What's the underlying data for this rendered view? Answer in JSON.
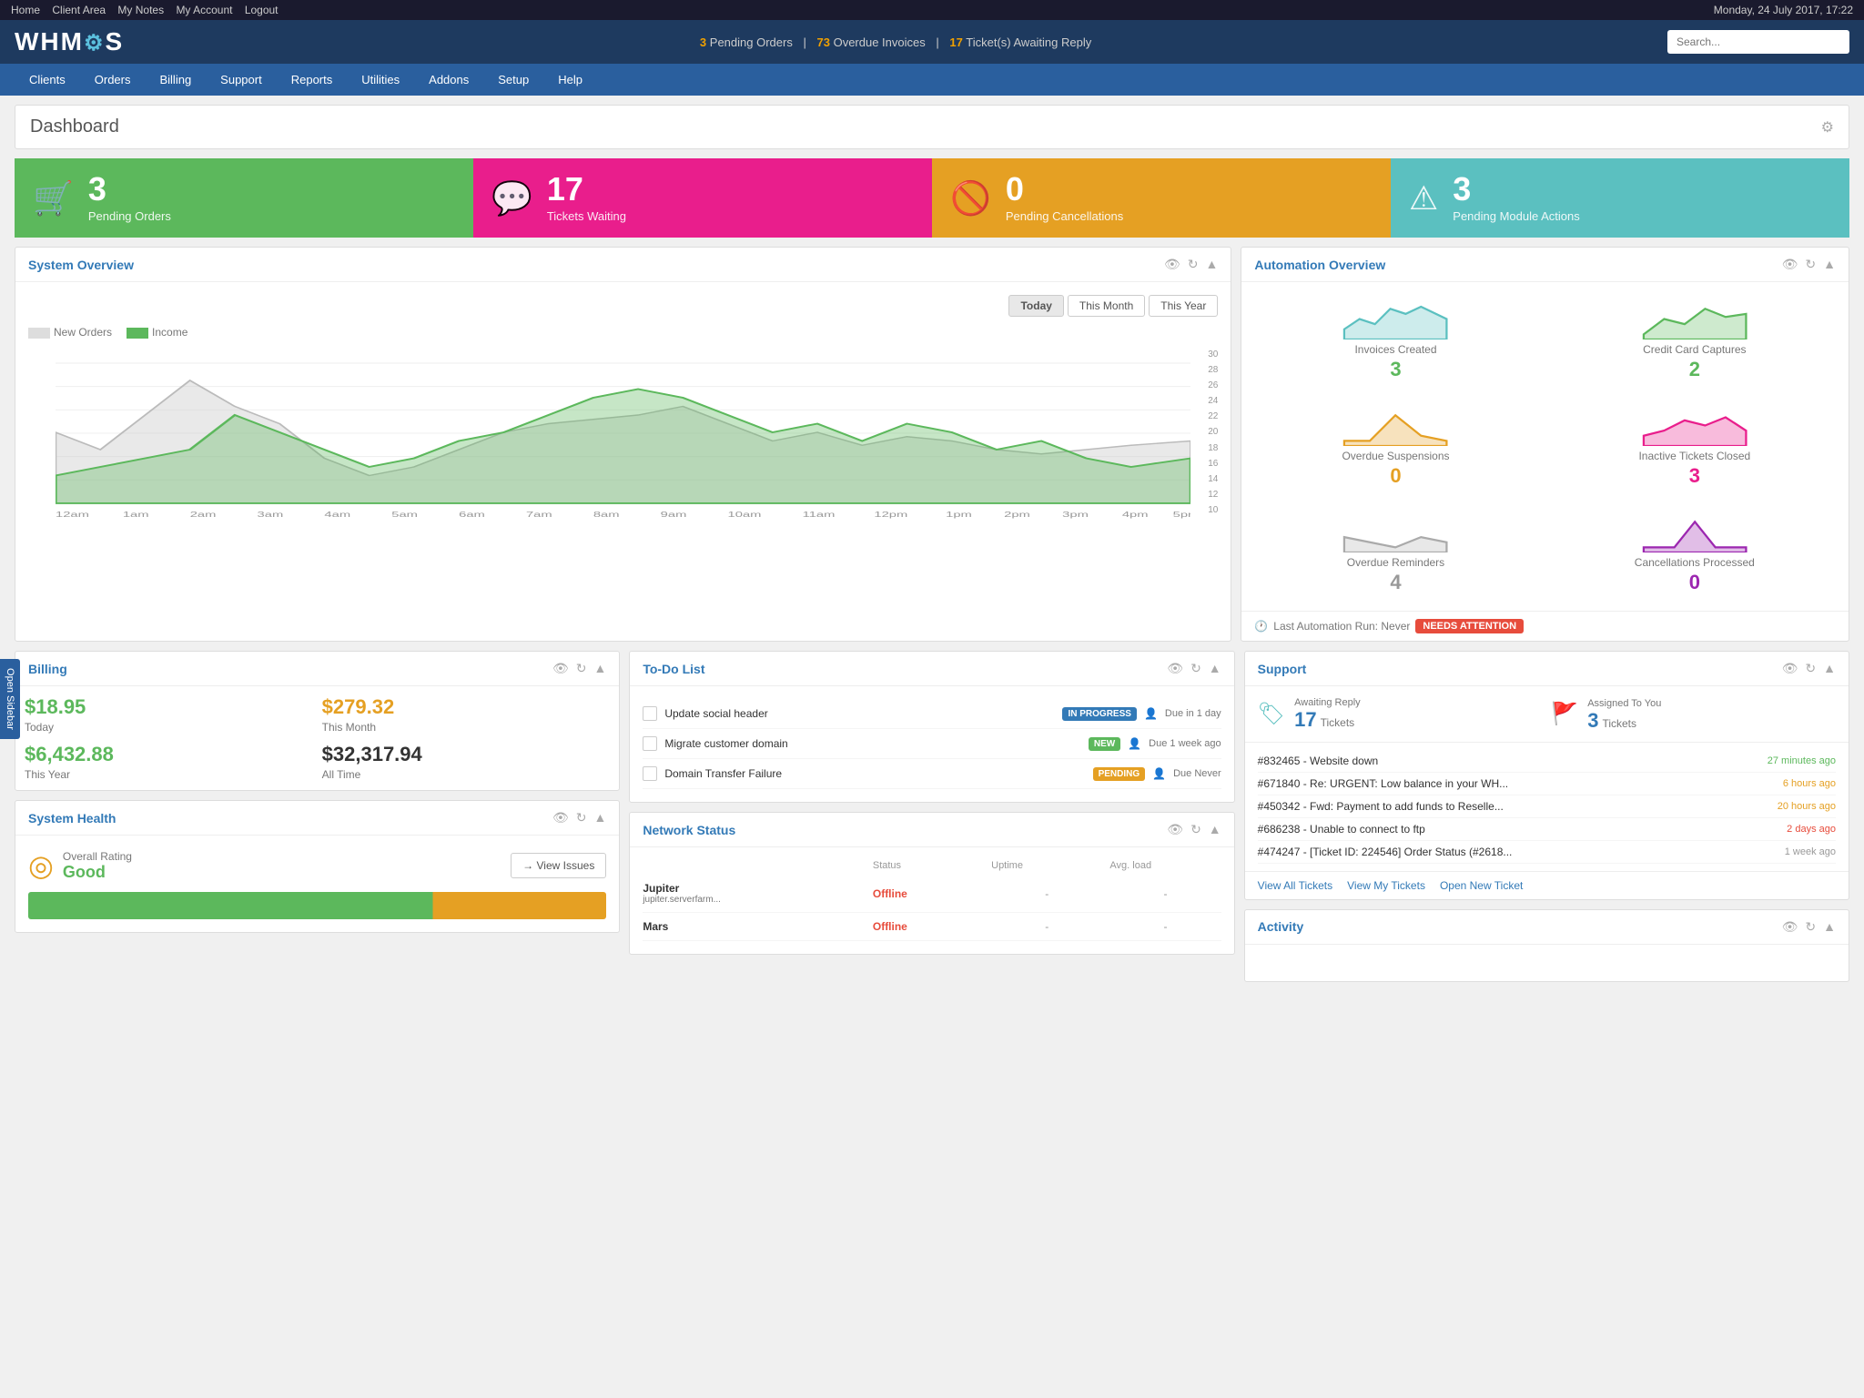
{
  "topbar": {
    "links": [
      "Home",
      "Client Area",
      "My Notes",
      "My Account",
      "Logout"
    ],
    "datetime": "Monday, 24 July 2017, 17:22"
  },
  "header": {
    "logo": "WHMC S",
    "notifications": {
      "pending_orders": "3",
      "overdue_invoices": "73",
      "tickets_awaiting": "17"
    },
    "search_placeholder": "Search..."
  },
  "nav": {
    "items": [
      "Clients",
      "Orders",
      "Billing",
      "Support",
      "Reports",
      "Utilities",
      "Addons",
      "Setup",
      "Help"
    ]
  },
  "dashboard": {
    "title": "Dashboard",
    "stats": [
      {
        "number": "3",
        "label": "Pending Orders",
        "color": "stat-green",
        "icon": "🛒"
      },
      {
        "number": "17",
        "label": "Tickets Waiting",
        "color": "stat-pink",
        "icon": "💬"
      },
      {
        "number": "0",
        "label": "Pending Cancellations",
        "color": "stat-orange",
        "icon": "🚫"
      },
      {
        "number": "3",
        "label": "Pending Module Actions",
        "color": "stat-teal",
        "icon": "⚠"
      }
    ]
  },
  "system_overview": {
    "title": "System Overview",
    "tabs": [
      "Today",
      "This Month",
      "This Year"
    ],
    "active_tab": "Today",
    "legend": {
      "new_orders": "New Orders",
      "income": "Income"
    }
  },
  "automation_overview": {
    "title": "Automation Overview",
    "items": [
      {
        "label": "Invoices Created",
        "value": "3",
        "color": "green",
        "chart": "teal"
      },
      {
        "label": "Credit Card Captures",
        "value": "2",
        "color": "green",
        "chart": "green"
      },
      {
        "label": "Overdue Suspensions",
        "value": "0",
        "color": "orange",
        "chart": "orange"
      },
      {
        "label": "Inactive Tickets Closed",
        "value": "3",
        "color": "pink",
        "chart": "pink"
      },
      {
        "label": "Overdue Reminders",
        "value": "4",
        "color": "gray",
        "chart": "gray"
      },
      {
        "label": "Cancellations Processed",
        "value": "0",
        "color": "purple",
        "chart": "purple"
      }
    ],
    "last_run_label": "Last Automation Run: Never",
    "attention_badge": "NEEDS ATTENTION"
  },
  "billing": {
    "title": "Billing",
    "items": [
      {
        "amount": "$18.95",
        "period": "Today",
        "color": "green"
      },
      {
        "amount": "$279.32",
        "period": "This Month",
        "color": "orange"
      },
      {
        "amount": "$6,432.88",
        "period": "This Year",
        "color": "green"
      },
      {
        "amount": "$32,317.94",
        "period": "All Time",
        "color": "black"
      }
    ]
  },
  "todo": {
    "title": "To-Do List",
    "items": [
      {
        "text": "Update social header",
        "badge": "IN PROGRESS",
        "badge_class": "badge-blue",
        "due": "Due in 1 day"
      },
      {
        "text": "Migrate customer domain",
        "badge": "NEW",
        "badge_class": "badge-new",
        "due": "Due 1 week ago"
      },
      {
        "text": "Domain Transfer Failure",
        "badge": "PENDING",
        "badge_class": "badge-pending",
        "due": "Due Never"
      }
    ]
  },
  "network_status": {
    "title": "Network Status",
    "headers": [
      "",
      "Status",
      "Uptime",
      "Avg. load"
    ],
    "items": [
      {
        "name": "Jupiter",
        "addr": "jupiter.serverfarm...",
        "status": "Offline",
        "uptime": "-",
        "avg_load": "-"
      },
      {
        "name": "Mars",
        "addr": "",
        "status": "Offline",
        "uptime": "-",
        "avg_load": "-"
      }
    ]
  },
  "support": {
    "title": "Support",
    "awaiting_reply": {
      "count": "17",
      "label": "Tickets"
    },
    "assigned_to_you": {
      "count": "3",
      "label": "Tickets"
    },
    "tickets": [
      {
        "id": "#832465",
        "desc": "Website down",
        "time": "27 minutes ago",
        "time_color": "green"
      },
      {
        "id": "#671840",
        "desc": "Re: URGENT: Low balance in your WH...",
        "time": "6 hours ago",
        "time_color": "orange"
      },
      {
        "id": "#450342",
        "desc": "Fwd: Payment to add funds to Reselle...",
        "time": "20 hours ago",
        "time_color": "orange"
      },
      {
        "id": "#686238",
        "desc": "Unable to connect to ftp",
        "time": "2 days ago",
        "time_color": "red"
      },
      {
        "id": "#474247",
        "desc": "[Ticket ID: 224546] Order Status (#2618...",
        "time": "1 week ago",
        "time_color": "gray"
      }
    ],
    "links": [
      "View All Tickets",
      "View My Tickets",
      "Open New Ticket"
    ]
  },
  "system_health": {
    "title": "System Health",
    "overall_label": "Overall Rating",
    "overall_value": "Good",
    "view_issues_label": "→ View Issues"
  },
  "activity": {
    "title": "Activity"
  },
  "sidebar": {
    "label": "Open Sidebar"
  }
}
